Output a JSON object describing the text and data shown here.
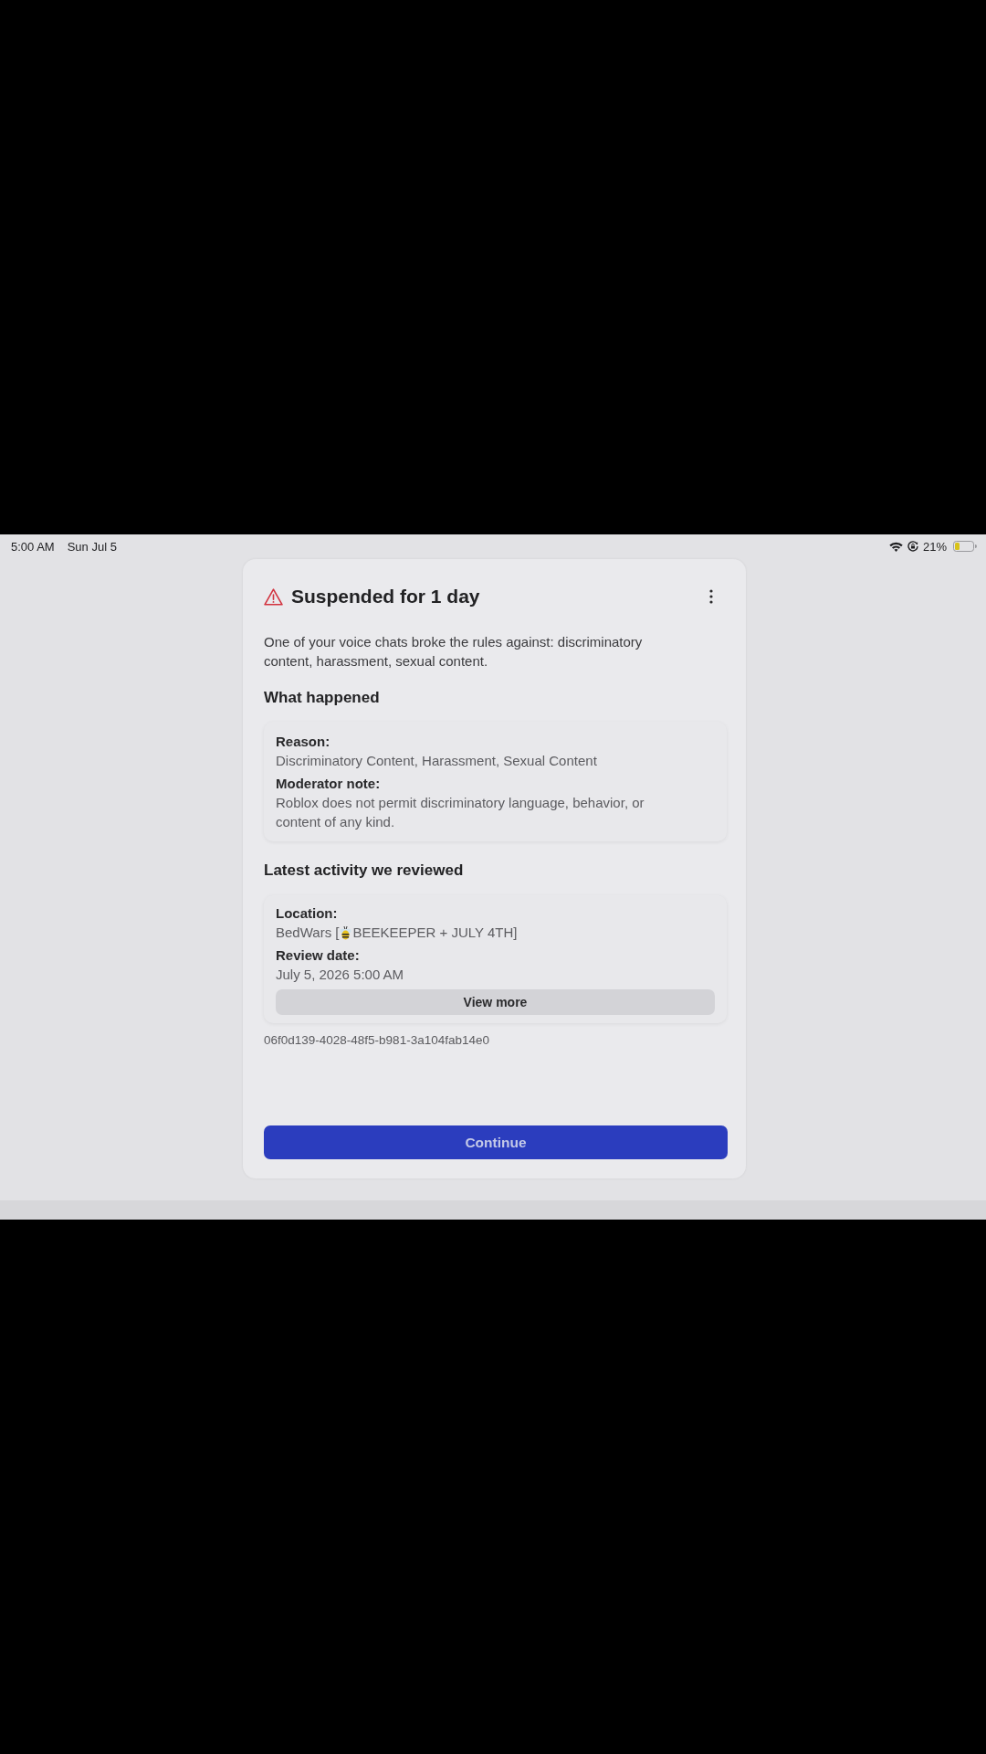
{
  "status_bar": {
    "time": "5:00 AM",
    "date": "Sun Jul 5",
    "battery": "21%"
  },
  "dialog": {
    "title": "Suspended for 1 day",
    "description": "One of your voice chats broke the rules against: discriminatory content, harassment, sexual content.",
    "sections": [
      {
        "heading": "What happened",
        "fields": [
          {
            "kind": "text",
            "label": "Reason:",
            "value": "Discriminatory Content, Harassment, Sexual Content"
          },
          {
            "kind": "text",
            "label": "Moderator note:",
            "value": "Roblox does not permit discriminatory language, behavior, or content of any kind."
          }
        ]
      },
      {
        "heading": "Latest activity we reviewed",
        "fields": [
          {
            "kind": "text_with_icon",
            "label": "Location:",
            "value_parts": [
              "BedWars [",
              "BEEKEEPER + JULY 4TH]"
            ]
          },
          {
            "kind": "text",
            "label": "Review date:",
            "value": "July 5, 2026 5:00 AM"
          }
        ],
        "button": "View more"
      }
    ],
    "reference_id": "06f0d139-4028-48f5-b981-3a104fab14e0",
    "primary_button": "Continue"
  }
}
